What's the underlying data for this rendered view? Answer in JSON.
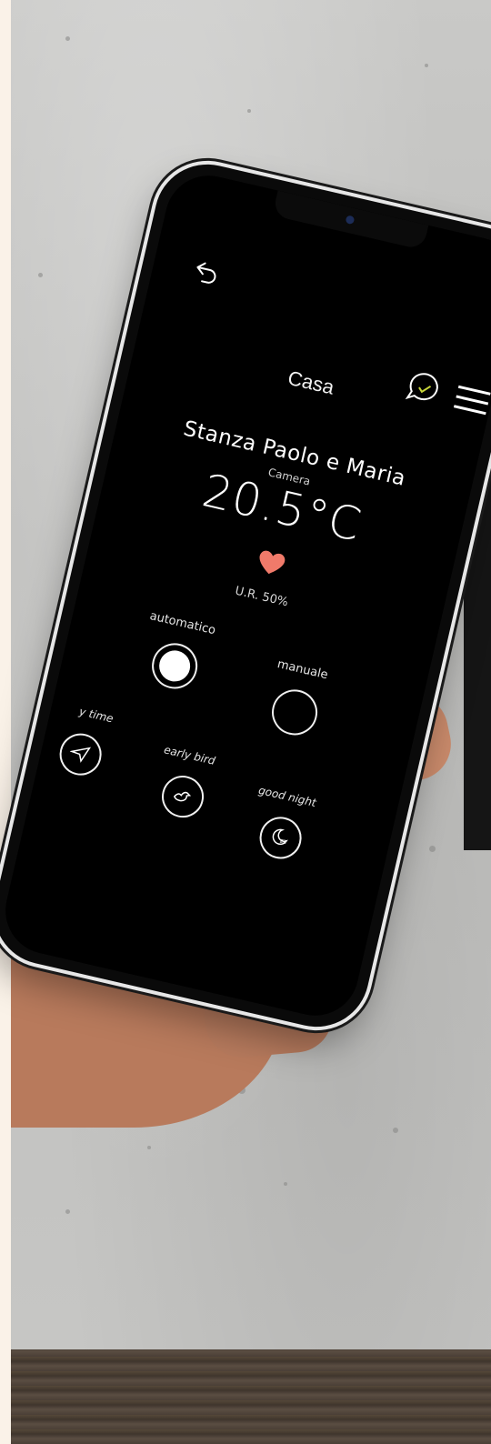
{
  "header": {
    "title": "Casa"
  },
  "room": {
    "name": "Stanza Paolo e Maria",
    "type": "Camera",
    "temperature": "20.5°C",
    "humidity": "U.R. 50%"
  },
  "modes": [
    {
      "label": "automatico",
      "active": true
    },
    {
      "label": "manuale",
      "active": false
    }
  ],
  "presets": [
    {
      "label": "y time",
      "icon": "send-icon"
    },
    {
      "label": "early bird",
      "icon": "bird-icon"
    },
    {
      "label": "good night",
      "icon": "moon-sleep-icon"
    }
  ],
  "colors": {
    "heart": "#f07a6a",
    "chat_check": "#c8d63a",
    "screen_bg": "#000000"
  }
}
